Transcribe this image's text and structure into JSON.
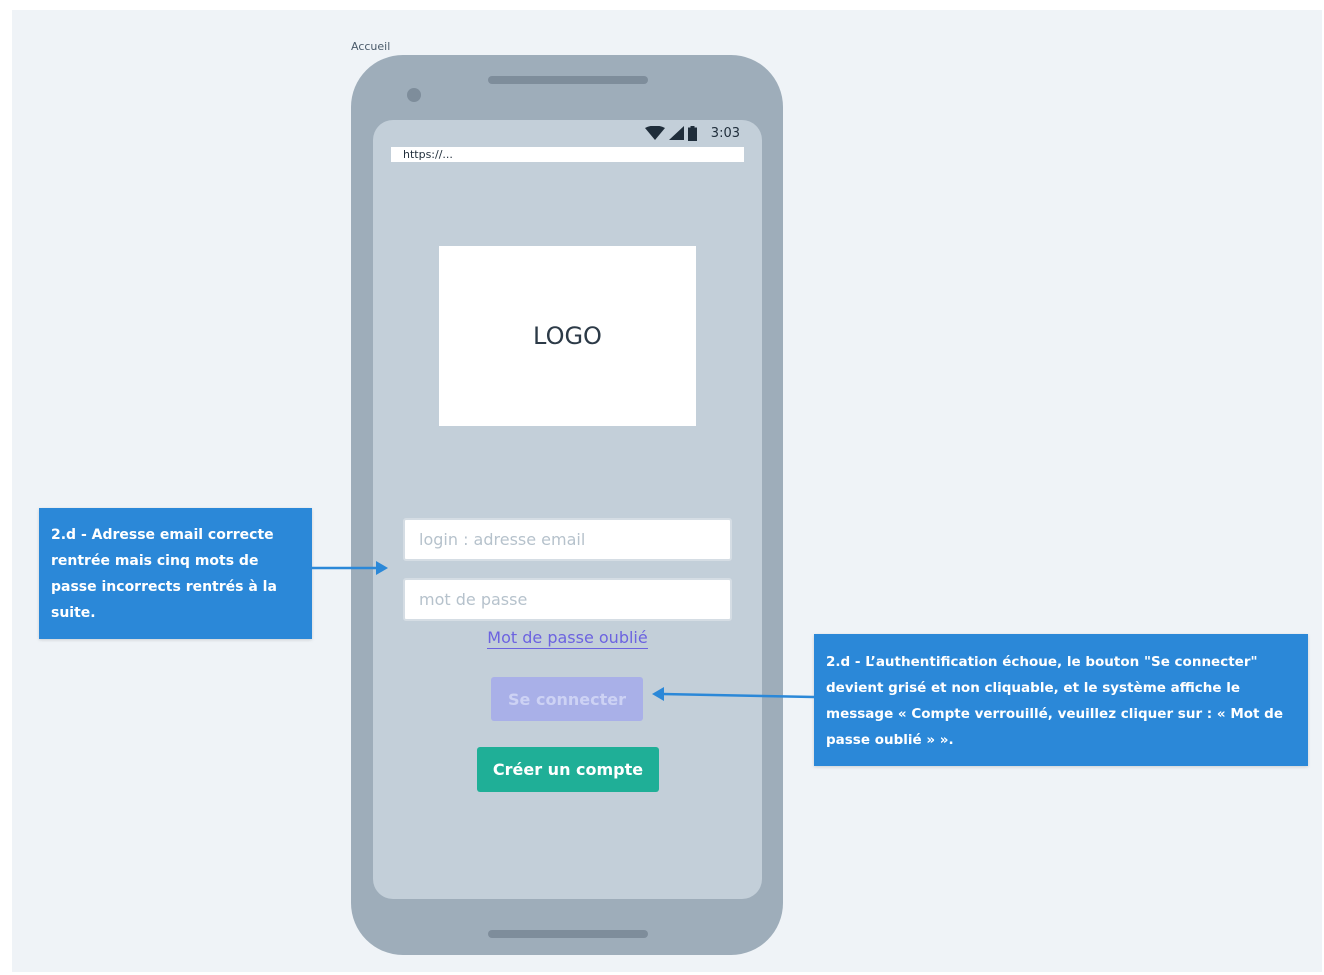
{
  "frame": {
    "label": "Accueil"
  },
  "status_bar": {
    "time": "3:03",
    "icons": [
      "wifi-icon",
      "cellular-signal-icon",
      "battery-icon"
    ]
  },
  "browser": {
    "url": "https://..."
  },
  "logo": {
    "text": "LOGO"
  },
  "login_form": {
    "email_placeholder": "login : adresse email",
    "email_value": "",
    "password_placeholder": "mot de passe",
    "password_value": "",
    "forgot_link": "Mot de passe oublié",
    "connect_button": "Se connecter",
    "connect_disabled": true,
    "create_button": "Créer un compte"
  },
  "annotations": {
    "left": "2.d - Adresse email correcte rentrée mais cinq mots de passe incorrects rentrés à la suite.",
    "right": "2.d - L’authentification échoue, le bouton \"Se connecter\" devient grisé et non cliquable, et le système affiche le message « Compte verrouillé, veuillez cliquer sur : « Mot de passe oublié » »."
  },
  "colors": {
    "canvas": "#eff3f7",
    "phone_body": "#9eadba",
    "screen": "#c3cfd9",
    "annotation": "#2b88d8",
    "link": "#6c63e0",
    "button_disabled": "#a9b0e8",
    "button_primary": "#1faf97"
  }
}
